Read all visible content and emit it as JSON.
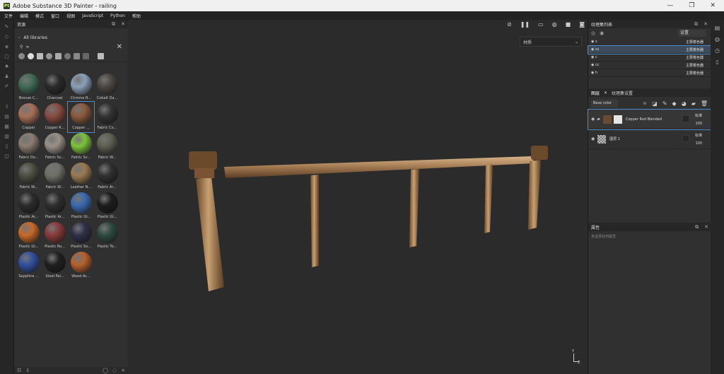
{
  "window": {
    "title": "Adobe Substance 3D Painter - railing",
    "logo": "Pt",
    "minimize": "—",
    "maximize": "❐",
    "close": "✕"
  },
  "menu": [
    "文件",
    "编辑",
    "模式",
    "窗口",
    "视图",
    "JavaScript",
    "Python",
    "帮助"
  ],
  "assets": {
    "title": "资源",
    "library": "All libraries",
    "search_value": "∞",
    "items": [
      {
        "label": "Bronze C...",
        "color": "#3f6b55"
      },
      {
        "label": "Charcoal",
        "color": "#2a2a2a"
      },
      {
        "label": "Chrome B...",
        "color": "#8aa0b8"
      },
      {
        "label": "Cobalt Da...",
        "color": "#4b4640"
      },
      {
        "label": "Copper",
        "color": "#a87058"
      },
      {
        "label": "Copper R...",
        "color": "#8a4a40"
      },
      {
        "label": "Copper ...",
        "color": "#8a5a3c"
      },
      {
        "label": "Fabric Co...",
        "color": "#333333"
      },
      {
        "label": "Fabric Do...",
        "color": "#8a7c70"
      },
      {
        "label": "Fabric Sv...",
        "color": "#9a9088"
      },
      {
        "label": "Fabric Sv...",
        "color": "#7cc43a"
      },
      {
        "label": "Fabric W...",
        "color": "#5e5e50"
      },
      {
        "label": "Fabric W...",
        "color": "#4c5040"
      },
      {
        "label": "Fabric W...",
        "color": "#707068"
      },
      {
        "label": "Leather N...",
        "color": "#9a7a50"
      },
      {
        "label": "Fabric Ar...",
        "color": "#303030"
      },
      {
        "label": "Plastic Ar...",
        "color": "#2c2c2c"
      },
      {
        "label": "Plastic Ar...",
        "color": "#2e2e2e"
      },
      {
        "label": "Plastic Gl...",
        "color": "#3a6ab0"
      },
      {
        "label": "Plastic Gl...",
        "color": "#1c1c1c"
      },
      {
        "label": "Plastic Gl...",
        "color": "#c86a28"
      },
      {
        "label": "Plastic Ro...",
        "color": "#8a3a3a"
      },
      {
        "label": "Plastic So...",
        "color": "#2e3048"
      },
      {
        "label": "Plastic To...",
        "color": "#2e4a40"
      },
      {
        "label": "Sapphire ...",
        "color": "#3050a0"
      },
      {
        "label": "Steel Pai...",
        "color": "#202020"
      },
      {
        "label": "Wood Ac...",
        "color": "#b8602c"
      }
    ]
  },
  "viewport": {
    "material_mode": "材质",
    "axis_y": "Y",
    "axis_z": "Z"
  },
  "texture_set_list": {
    "title": "纹理集列表",
    "settings": "设置",
    "rows": [
      {
        "name": "s",
        "shader": "主要着色器"
      },
      {
        "name": "ss",
        "shader": "主要着色器"
      },
      {
        "name": "c",
        "shader": "主要着色器"
      },
      {
        "name": "cc",
        "shader": "主要着色器"
      },
      {
        "name": "h",
        "shader": "主要着色器"
      }
    ]
  },
  "layers": {
    "tab_layers": "图层",
    "tab_settings": "纹理集设置",
    "channel": "Base color",
    "items": [
      {
        "name": "Copper Rod Blended",
        "blend": "标准",
        "opacity": "100"
      },
      {
        "name": "图层 1",
        "blend": "标准",
        "opacity": "100"
      }
    ]
  },
  "properties": {
    "title": "属性",
    "empty": "未选择任何属性"
  }
}
